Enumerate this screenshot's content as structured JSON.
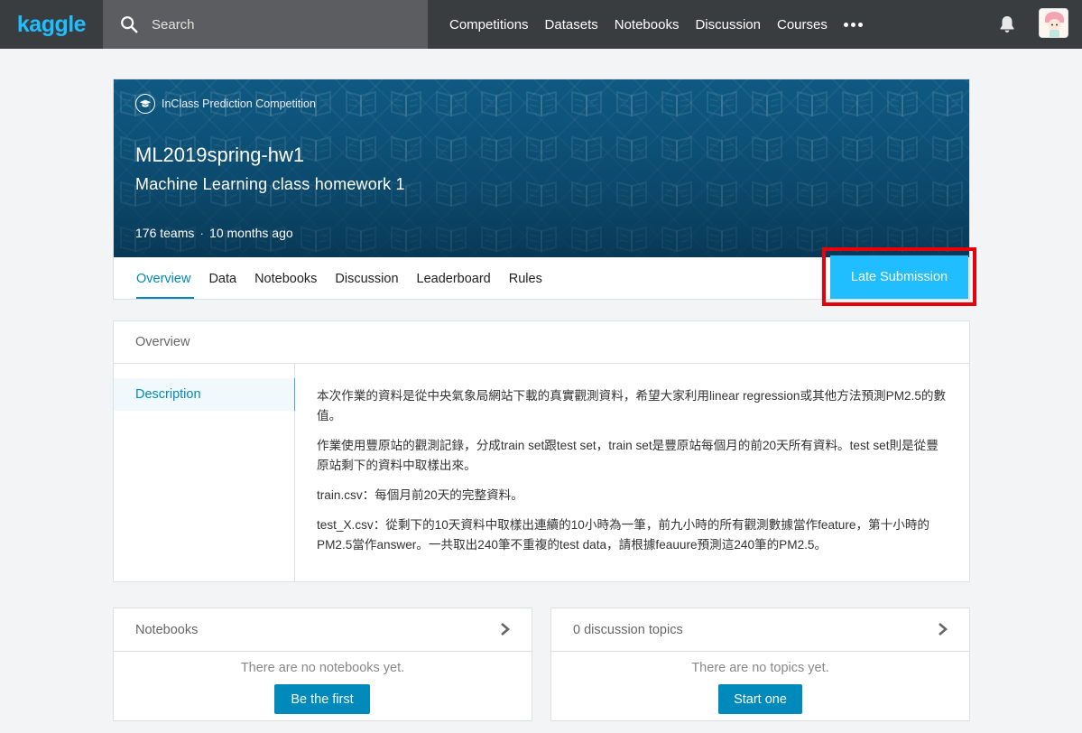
{
  "topbar": {
    "logo": "kaggle",
    "search_placeholder": "Search",
    "nav": [
      "Competitions",
      "Datasets",
      "Notebooks",
      "Discussion",
      "Courses"
    ]
  },
  "competition": {
    "type_label": "InClass Prediction Competition",
    "title": "ML2019spring-hw1",
    "subtitle": "Machine Learning class homework 1",
    "teams": "176 teams",
    "separator": "·",
    "age": "10 months ago",
    "tabs": [
      "Overview",
      "Data",
      "Notebooks",
      "Discussion",
      "Leaderboard",
      "Rules"
    ],
    "active_tab": "Overview",
    "late_submission_label": "Late Submission"
  },
  "overview": {
    "header": "Overview",
    "side_item": "Description",
    "paragraphs": [
      "本次作業的資料是從中央氣象局網站下載的真實觀測資料，希望大家利用linear regression或其他方法預測PM2.5的數值。",
      "作業使用豐原站的觀測記錄，分成train set跟test set，train set是豐原站每個月的前20天所有資料。test set則是從豐原站剩下的資料中取樣出來。",
      "train.csv：每個月前20天的完整資料。",
      "test_X.csv：從剩下的10天資料中取樣出連續的10小時為一筆，前九小時的所有觀測數據當作feature，第十小時的PM2.5當作answer。一共取出240筆不重複的test data，請根據feauure預測這240筆的PM2.5。"
    ]
  },
  "notebooks_card": {
    "title": "Notebooks",
    "empty": "There are no notebooks yet.",
    "button": "Be the first"
  },
  "discussion_card": {
    "title": "0 discussion topics",
    "empty": "There are no topics yet.",
    "button": "Start one"
  },
  "colors": {
    "accent": "#20beff",
    "link": "#008abc",
    "highlight": "#e8000b",
    "topbar": "#3a3d40"
  }
}
